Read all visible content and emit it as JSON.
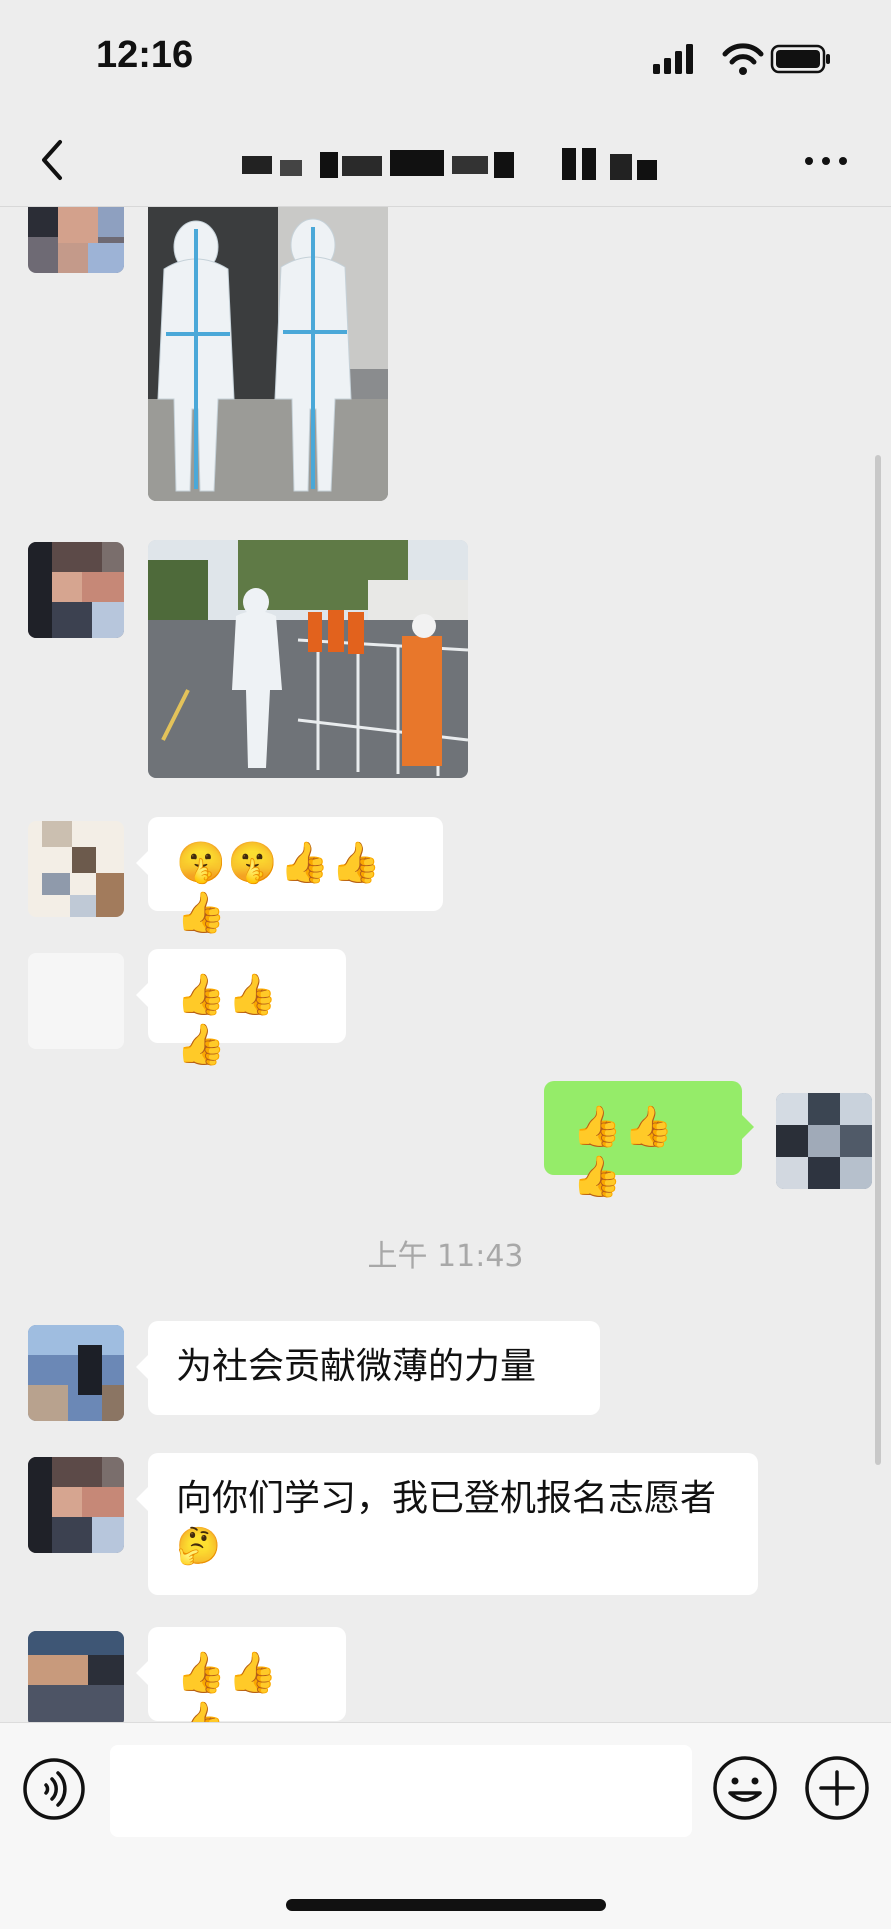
{
  "status_bar": {
    "time": "12:16"
  },
  "nav": {
    "title": ""
  },
  "messages": [
    {
      "type": "image",
      "sender": "other",
      "image_icon": "photo-two-workers-in-protective-suits"
    },
    {
      "type": "image",
      "sender": "other",
      "image_icon": "photo-street-checkpoint-with-workers"
    },
    {
      "type": "text",
      "sender": "other",
      "text": "🤫🤫👍👍👍"
    },
    {
      "type": "text",
      "sender": "other",
      "text": "👍👍👍"
    },
    {
      "type": "text",
      "sender": "self",
      "text": "👍👍👍"
    },
    {
      "type": "time",
      "text": "上午 11:43"
    },
    {
      "type": "text",
      "sender": "other",
      "text": "为社会贡献微薄的力量"
    },
    {
      "type": "text",
      "sender": "other",
      "text": "向你们学习，我已登机报名志愿者🤔"
    },
    {
      "type": "text",
      "sender": "other",
      "text": "👍👍👍"
    }
  ],
  "input": {
    "placeholder": ""
  },
  "colors": {
    "background": "#ededed",
    "self_bubble": "#95ec69",
    "other_bubble": "#ffffff"
  }
}
